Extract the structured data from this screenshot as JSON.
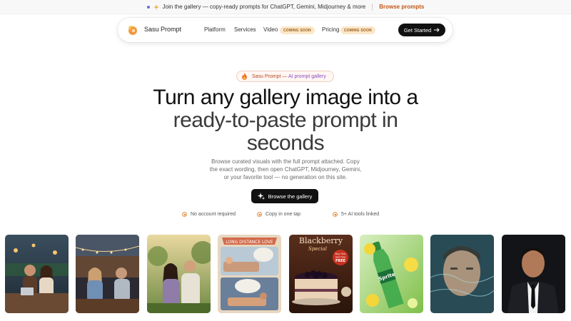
{
  "announcement": {
    "text": "Join the gallery — copy-ready prompts for ChatGPT, Gemini, Midjourney & more",
    "link": "Browse prompts"
  },
  "nav": {
    "brand": "Sasu Prompt",
    "links": [
      "Platform",
      "Services",
      "Video",
      "Pricing"
    ],
    "coming_soon": "COMING SOON",
    "cta": "Get Started",
    "cta_icon": "arrow-right-icon"
  },
  "hero": {
    "badge": "Sasu Prompt — AI prompt gallery",
    "badge_head": "Sasu Prompt — ",
    "badge_tail": "AI prompt gallery",
    "title_line1": "Turn any gallery image into a",
    "title_line2": "ready-to-paste prompt in",
    "title_line3": "seconds",
    "subtitle_line1": "Browse curated visuals with the full prompt attached. Copy",
    "subtitle_line2": "the exact wording, then open ChatGPT, Midjourney, Gemini,",
    "subtitle_line3": "or your favorite tool — no generation on this site.",
    "button": "Browse the gallery",
    "button_icon": "sparkle-icon",
    "features": [
      "No account required",
      "Copy in one tap",
      "5+ AI tools linked"
    ]
  },
  "gallery": {
    "items": [
      {
        "name": "couple-cafe-laptop"
      },
      {
        "name": "couple-cafe-night"
      },
      {
        "name": "couple-garden"
      },
      {
        "name": "long-distance-love",
        "caption": "LONG DISTANCE LOVE"
      },
      {
        "name": "blackberry-cake",
        "caption": "Blackberry",
        "caption2": "Special",
        "sticker_line1": "Buy One",
        "sticker_line2": "Get One",
        "sticker_line3": "FREE"
      },
      {
        "name": "sprite-bottle",
        "caption": "Sprite"
      },
      {
        "name": "man-water-portrait"
      },
      {
        "name": "man-suit-portrait"
      }
    ]
  },
  "colors": {
    "accent": "#c2571a",
    "dark": "#111111",
    "soon_bg": "#fbe7c8"
  }
}
